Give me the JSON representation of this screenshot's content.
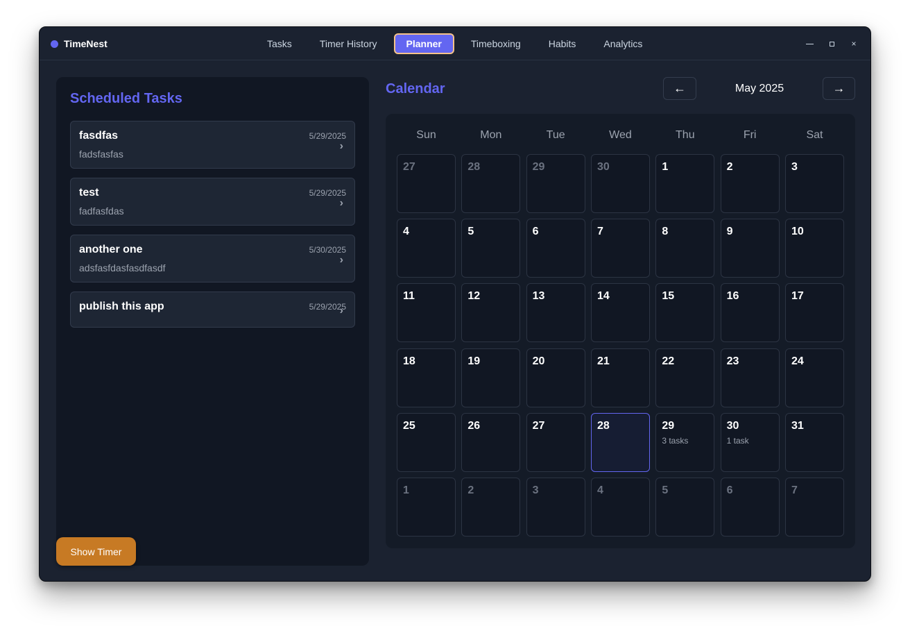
{
  "app": {
    "name": "TimeNest",
    "accent": "#6366f1"
  },
  "nav": {
    "tabs": [
      {
        "label": "Tasks",
        "active": false
      },
      {
        "label": "Timer History",
        "active": false
      },
      {
        "label": "Planner",
        "active": true
      },
      {
        "label": "Timeboxing",
        "active": false
      },
      {
        "label": "Habits",
        "active": false
      },
      {
        "label": "Analytics",
        "active": false
      }
    ]
  },
  "window_controls": {
    "minimize_icon": "minimize-icon",
    "maximize_icon": "maximize-icon",
    "close_label": "×"
  },
  "scheduled": {
    "title": "Scheduled Tasks",
    "tasks": [
      {
        "title": "fasdfas",
        "description": "fadsfasfas",
        "date": "5/29/2025"
      },
      {
        "title": "test",
        "description": "fadfasfdas",
        "date": "5/29/2025"
      },
      {
        "title": "another one",
        "description": "adsfasfdasfasdfasdf",
        "date": "5/30/2025"
      },
      {
        "title": "publish this app",
        "description": "",
        "date": "5/29/2025"
      }
    ],
    "chevron": "›"
  },
  "show_timer": {
    "label": "Show Timer",
    "color": "#c77a24"
  },
  "calendar": {
    "title": "Calendar",
    "month_label": "May 2025",
    "prev_label": "←",
    "next_label": "→",
    "weekdays": [
      "Sun",
      "Mon",
      "Tue",
      "Wed",
      "Thu",
      "Fri",
      "Sat"
    ],
    "days": [
      {
        "day": "27",
        "current": false
      },
      {
        "day": "28",
        "current": false
      },
      {
        "day": "29",
        "current": false
      },
      {
        "day": "30",
        "current": false
      },
      {
        "day": "1",
        "current": true
      },
      {
        "day": "2",
        "current": true
      },
      {
        "day": "3",
        "current": true
      },
      {
        "day": "4",
        "current": true
      },
      {
        "day": "5",
        "current": true
      },
      {
        "day": "6",
        "current": true
      },
      {
        "day": "7",
        "current": true
      },
      {
        "day": "8",
        "current": true
      },
      {
        "day": "9",
        "current": true
      },
      {
        "day": "10",
        "current": true
      },
      {
        "day": "11",
        "current": true
      },
      {
        "day": "12",
        "current": true
      },
      {
        "day": "13",
        "current": true
      },
      {
        "day": "14",
        "current": true
      },
      {
        "day": "15",
        "current": true
      },
      {
        "day": "16",
        "current": true
      },
      {
        "day": "17",
        "current": true
      },
      {
        "day": "18",
        "current": true
      },
      {
        "day": "19",
        "current": true
      },
      {
        "day": "20",
        "current": true
      },
      {
        "day": "21",
        "current": true
      },
      {
        "day": "22",
        "current": true
      },
      {
        "day": "23",
        "current": true
      },
      {
        "day": "24",
        "current": true
      },
      {
        "day": "25",
        "current": true
      },
      {
        "day": "26",
        "current": true
      },
      {
        "day": "27",
        "current": true
      },
      {
        "day": "28",
        "current": true,
        "today": true
      },
      {
        "day": "29",
        "current": true,
        "tasks": "3 tasks"
      },
      {
        "day": "30",
        "current": true,
        "tasks": "1 task"
      },
      {
        "day": "31",
        "current": true
      },
      {
        "day": "1",
        "current": false
      },
      {
        "day": "2",
        "current": false
      },
      {
        "day": "3",
        "current": false
      },
      {
        "day": "4",
        "current": false
      },
      {
        "day": "5",
        "current": false
      },
      {
        "day": "6",
        "current": false
      },
      {
        "day": "7",
        "current": false
      }
    ]
  }
}
